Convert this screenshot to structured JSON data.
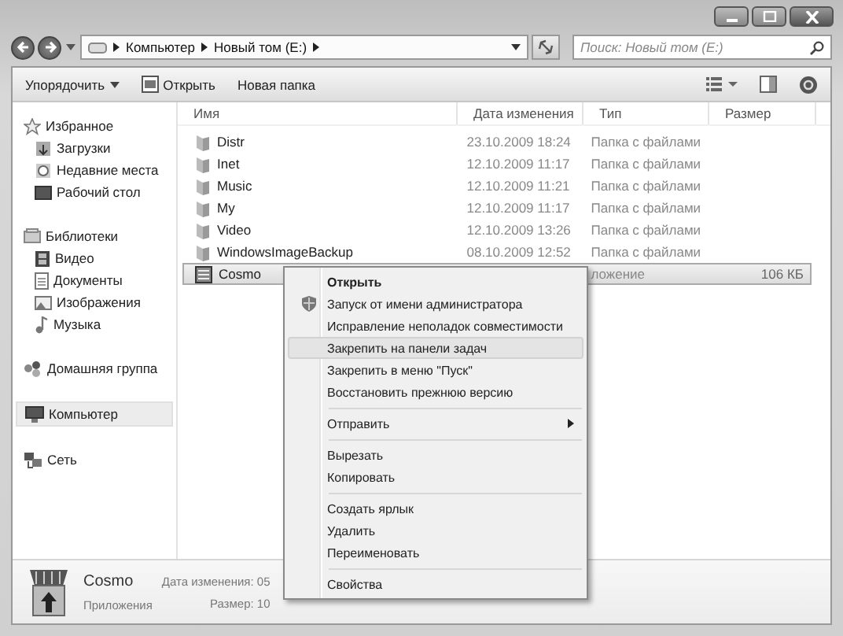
{
  "address_bar": {
    "segments": [
      "Компьютер",
      "Новый том (E:)"
    ]
  },
  "search": {
    "placeholder": "Поиск: Новый том (E:)"
  },
  "toolbar": {
    "buttons": [
      {
        "label": "Упорядочить",
        "kind": "dropdown"
      },
      {
        "label": "Открыть",
        "kind": "icon"
      },
      {
        "label": "Новая папка",
        "kind": "plain"
      }
    ]
  },
  "sidebar": {
    "groups": [
      {
        "label": "Избранное",
        "selected": false,
        "children": [
          {
            "label": "Загрузки",
            "selected": false
          },
          {
            "label": "Недавние места",
            "selected": false
          },
          {
            "label": "Рабочий стол",
            "selected": false
          }
        ]
      },
      {
        "label": "Библиотеки",
        "selected": false,
        "children": [
          {
            "label": "Видео",
            "selected": false
          },
          {
            "label": "Документы",
            "selected": false
          },
          {
            "label": "Изображения",
            "selected": false
          },
          {
            "label": "Музыка",
            "selected": false
          }
        ]
      },
      {
        "label": "Домашняя группа",
        "selected": false
      },
      {
        "label": "Компьютер",
        "selected": true
      },
      {
        "label": "Сеть",
        "selected": false
      }
    ]
  },
  "table": {
    "columns": [
      "Имя",
      "Дата изменения",
      "Тип",
      "Размер"
    ],
    "rows": [
      {
        "name": "Distr",
        "date": "23.10.2009 18:24",
        "type": "Папка с файлами",
        "kind": "folder",
        "selected": false
      },
      {
        "name": "Inet",
        "date": "12.10.2009 11:17",
        "type": "Папка с файлами",
        "kind": "folder",
        "selected": false
      },
      {
        "name": "Music",
        "date": "12.10.2009 11:21",
        "type": "Папка с файлами",
        "kind": "folder",
        "selected": false
      },
      {
        "name": "My",
        "date": "12.10.2009 11:17",
        "type": "Папка с файлами",
        "kind": "folder",
        "selected": false
      },
      {
        "name": "Video",
        "date": "12.10.2009 13:26",
        "type": "Папка с файлами",
        "kind": "folder",
        "selected": false
      },
      {
        "name": "WindowsImageBackup",
        "date": "08.10.2009 12:52",
        "type": "Папка с файлами",
        "kind": "folder",
        "selected": false
      },
      {
        "name": "Cosmo",
        "type": "ложение",
        "size": "106 КБ",
        "kind": "app",
        "selected": true
      }
    ]
  },
  "context_menu": {
    "items": [
      {
        "kind": "item",
        "label": "Открыть",
        "default": true,
        "selected": false
      },
      {
        "kind": "item",
        "label": "Запуск от имени администратора",
        "default": false,
        "selected": false,
        "shield": true
      },
      {
        "kind": "item",
        "label": "Исправление неполадок совместимости",
        "default": false,
        "selected": false
      },
      {
        "kind": "item",
        "label": "Закрепить на панели задач",
        "default": false,
        "selected": true
      },
      {
        "kind": "item",
        "label": "Закрепить в меню \"Пуск\"",
        "default": false,
        "selected": false
      },
      {
        "kind": "item",
        "label": "Восстановить прежнюю версию",
        "default": false,
        "selected": false
      },
      {
        "kind": "separator"
      },
      {
        "kind": "item",
        "label": "Отправить",
        "default": false,
        "selected": false,
        "submenu": true
      },
      {
        "kind": "separator"
      },
      {
        "kind": "item",
        "label": "Вырезать",
        "default": false,
        "selected": false
      },
      {
        "kind": "item",
        "label": "Копировать",
        "default": false,
        "selected": false
      },
      {
        "kind": "separator"
      },
      {
        "kind": "item",
        "label": "Создать ярлык",
        "default": false,
        "selected": false
      },
      {
        "kind": "item",
        "label": "Удалить",
        "default": false,
        "selected": false
      },
      {
        "kind": "item",
        "label": "Переименовать",
        "default": false,
        "selected": false
      },
      {
        "kind": "separator"
      },
      {
        "kind": "item",
        "label": "Свойства",
        "default": false,
        "selected": false
      }
    ]
  },
  "details": {
    "name": "Cosmo",
    "type": "Приложения",
    "date_label": "Дата изменения: 05",
    "size_label": "Размер: 10"
  }
}
